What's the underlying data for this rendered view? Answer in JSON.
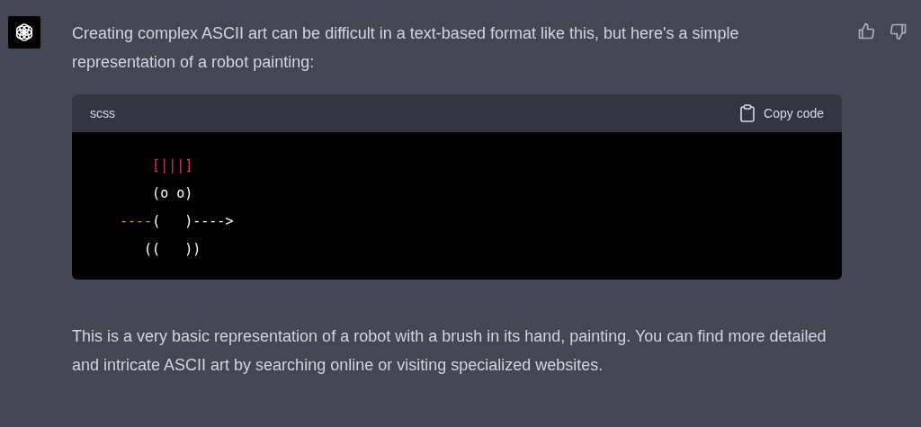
{
  "message": {
    "intro": "Creating complex ASCII art can be difficult in a text-based format like this, but here's a simple representation of a robot painting:",
    "code": {
      "language": "scss",
      "copy_label": "Copy code",
      "lines": [
        [
          {
            "kind": "tag",
            "text": "    [|||]"
          }
        ],
        [
          {
            "kind": "plain",
            "text": "    (o o)"
          }
        ],
        [
          {
            "kind": "attr",
            "text": "----"
          },
          {
            "kind": "plain",
            "text": "(   )---->"
          }
        ],
        [
          {
            "kind": "plain",
            "text": "   ((   ))"
          }
        ]
      ]
    },
    "outro": "This is a very basic representation of a robot with a brush in its hand, painting. You can find more detailed and intricate ASCII art by searching online or visiting specialized websites."
  }
}
